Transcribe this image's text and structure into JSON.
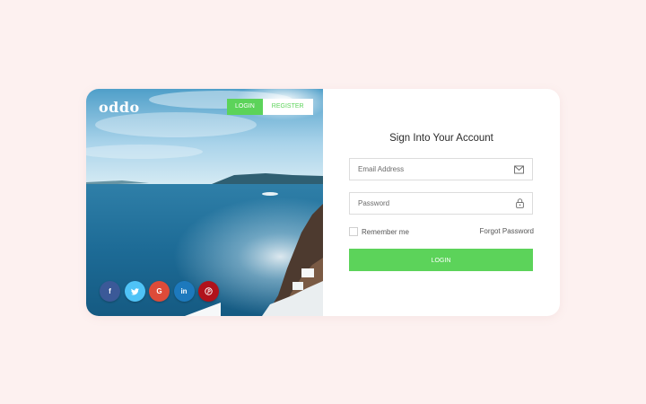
{
  "brand": {
    "logo_text": "oddo"
  },
  "tabs": [
    {
      "label": "LOGIN",
      "active": true
    },
    {
      "label": "REGISTER",
      "active": false
    }
  ],
  "socials": [
    {
      "name": "facebook",
      "glyph": "f",
      "color": "#3b5998"
    },
    {
      "name": "twitter",
      "glyph": "🐦",
      "color": "#4fc3f7"
    },
    {
      "name": "google",
      "glyph": "G",
      "color": "#dd4b39"
    },
    {
      "name": "linkedin",
      "glyph": "in",
      "color": "#1d79bd"
    },
    {
      "name": "pinterest",
      "glyph": "P",
      "color": "#b0121b"
    }
  ],
  "form": {
    "title": "Sign Into Your Account",
    "email_placeholder": "Email Address",
    "email_icon": "envelope-icon",
    "password_placeholder": "Password",
    "password_icon": "lock-icon",
    "remember_label": "Remember me",
    "forgot_label": "Forgot Password",
    "submit_label": "LOGIN"
  },
  "colors": {
    "page_background": "#fdf1f0",
    "accent": "#5cd35a",
    "card": "#ffffff"
  }
}
